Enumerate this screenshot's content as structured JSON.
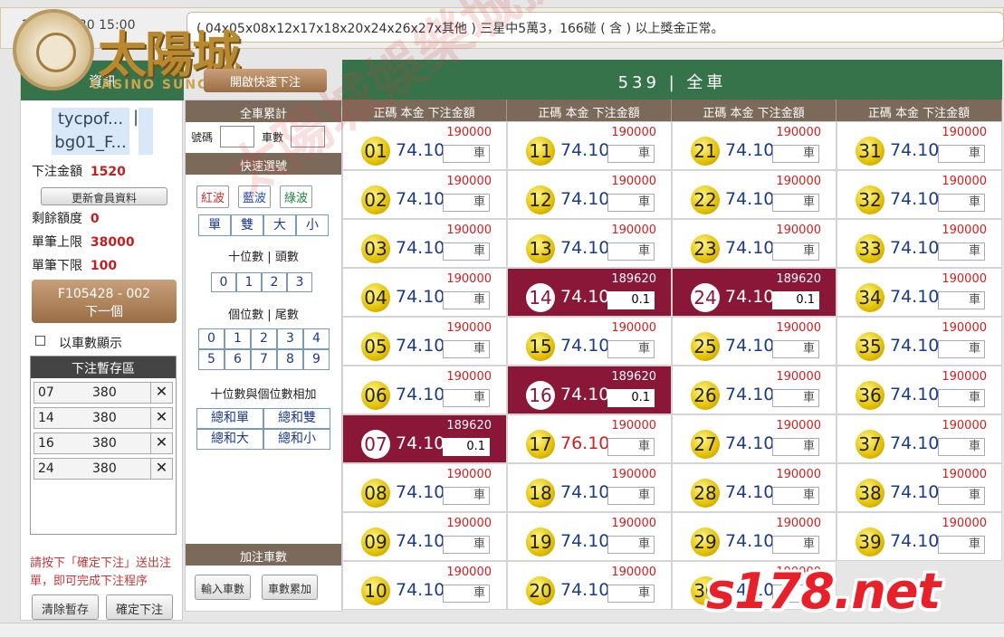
{
  "ticker": {
    "timestamp": "2019/02/20 15:00",
    "text": "( 04x05x08x12x17x18x20x24x26x27x其他 ) 三星中5萬3，166碰 ( 含 ) 以上獎金正常。"
  },
  "logo": {
    "cn": "太陽城",
    "en": "CASINO SUNCITY"
  },
  "left": {
    "header": "資訊",
    "user1": "tycpof...",
    "user2": "bg01_F...",
    "separator": "|",
    "bet_amount_label": "下注金額",
    "bet_amount": "1520",
    "update_button": "更新會員資料",
    "remaining_label": "剩餘額度",
    "remaining": "0",
    "max_label": "單筆上限",
    "max": "38000",
    "min_label": "單筆下限",
    "min": "100",
    "order_id": "F105428 - 002",
    "next_label": "下一個",
    "show_by_count_label": "以車數顯示",
    "queue_title": "下注暫存區",
    "queue": [
      {
        "num": "07",
        "amt": "380"
      },
      {
        "num": "14",
        "amt": "380"
      },
      {
        "num": "16",
        "amt": "380"
      },
      {
        "num": "24",
        "amt": "380"
      }
    ],
    "note": "請按下「確定下注」送出注單，即可完成下注程序",
    "clear_button": "清除暫存",
    "confirm_button": "確定下注"
  },
  "mid": {
    "quick_button": "開啟快速下注",
    "sum_header": "全車累計",
    "num_label": "號碼",
    "count_label": "車數",
    "quick_header": "快速選號",
    "waves": [
      "紅波",
      "藍波",
      "綠波"
    ],
    "wave_colors": [
      "#c03030",
      "#2050b0",
      "#208040"
    ],
    "types": [
      "單",
      "雙",
      "大",
      "小"
    ],
    "tens_label": "十位數 | 頭數",
    "tens": [
      "0",
      "1",
      "2",
      "3"
    ],
    "units_label": "個位數 | 尾數",
    "units_row1": [
      "0",
      "1",
      "2",
      "3",
      "4"
    ],
    "units_row2": [
      "5",
      "6",
      "7",
      "8",
      "9"
    ],
    "sum_label": "十位數與個位數相加",
    "sum_row1": [
      "總和單",
      "總和雙"
    ],
    "sum_row2": [
      "總和大",
      "總和小"
    ],
    "add_header": "加注車數",
    "input_button": "輸入車數",
    "accum_button": "車數累加"
  },
  "grid": {
    "title": "539 | 全車",
    "col_header": "正碼 本金 下注金額",
    "default_rate": "74.10",
    "default_limit": "190000",
    "default_input": "車",
    "cells": [
      {
        "n": "01"
      },
      {
        "n": "02"
      },
      {
        "n": "03"
      },
      {
        "n": "04"
      },
      {
        "n": "05"
      },
      {
        "n": "06"
      },
      {
        "n": "07",
        "sel": true,
        "limit": "189620",
        "input": "0.1"
      },
      {
        "n": "08"
      },
      {
        "n": "09"
      },
      {
        "n": "10"
      },
      {
        "n": "11"
      },
      {
        "n": "12"
      },
      {
        "n": "13"
      },
      {
        "n": "14",
        "sel": true,
        "limit": "189620",
        "input": "0.1"
      },
      {
        "n": "15"
      },
      {
        "n": "16",
        "sel": true,
        "limit": "189620",
        "input": "0.1"
      },
      {
        "n": "17",
        "rate": "76.10",
        "red": true
      },
      {
        "n": "18"
      },
      {
        "n": "19"
      },
      {
        "n": "20"
      },
      {
        "n": "21"
      },
      {
        "n": "22"
      },
      {
        "n": "23"
      },
      {
        "n": "24",
        "sel": true,
        "limit": "189620",
        "input": "0.1"
      },
      {
        "n": "25"
      },
      {
        "n": "26"
      },
      {
        "n": "27"
      },
      {
        "n": "28"
      },
      {
        "n": "29"
      },
      {
        "n": "30"
      },
      {
        "n": "31"
      },
      {
        "n": "32"
      },
      {
        "n": "33"
      },
      {
        "n": "34"
      },
      {
        "n": "35"
      },
      {
        "n": "36"
      },
      {
        "n": "37"
      },
      {
        "n": "38"
      },
      {
        "n": "39"
      }
    ]
  },
  "watermark": "太陽城娛樂城提供",
  "site_logo": "s178.net"
}
